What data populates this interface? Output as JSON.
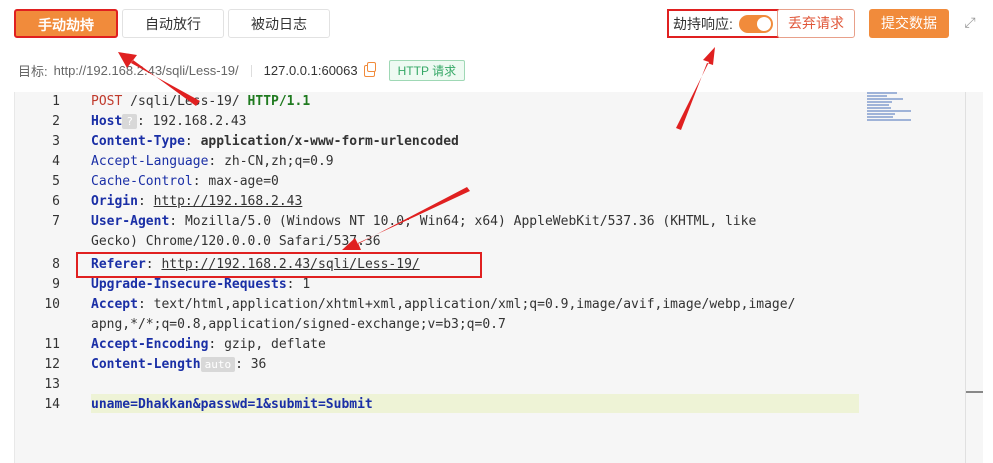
{
  "tabs": [
    {
      "label": "手动劫持",
      "active": true
    },
    {
      "label": "自动放行",
      "active": false
    },
    {
      "label": "被动日志",
      "active": false
    }
  ],
  "hijack_response": {
    "label": "劫持响应:",
    "enabled": true
  },
  "buttons": {
    "discard": "丢弃请求",
    "submit": "提交数据"
  },
  "icons": {
    "expand": "expand-icon",
    "copy": "copy-icon"
  },
  "target": {
    "prefix": "目标:",
    "url": "http://192.168.2.43/sqli/Less-19/",
    "host": "127.0.0.1:60063",
    "badge": "HTTP 请求"
  },
  "request_lines": {
    "l1_method": "POST",
    "l1_path": "/sqli/Less-19/",
    "l1_proto": "HTTP/1.1",
    "l2_key": "Host",
    "l2_hint": "?",
    "l2_val": "192.168.2.43",
    "l3_key": "Content-Type",
    "l3_val": "application/x-www-form-urlencoded",
    "l4_key": "Accept-Language",
    "l4_val": "zh-CN,zh;q=0.9",
    "l5_key": "Cache-Control",
    "l5_val": "max-age=0",
    "l6_key": "Origin",
    "l6_val": "http://192.168.2.43",
    "l7_key": "User-Agent",
    "l7_val_a": "Mozilla/5.0 (Windows NT 10.0; Win64; x64) AppleWebKit/537.36 (KHTML, like",
    "l7_val_b": "Gecko) Chrome/120.0.0.0 Safari/537.36",
    "l8_key": "Referer",
    "l8_val": "http://192.168.2.43/sqli/Less-19/",
    "l9_key": "Upgrade-Insecure-Requests",
    "l9_val": "1",
    "l10_key": "Accept",
    "l10_val_a": "text/html,application/xhtml+xml,application/xml;q=0.9,image/avif,image/webp,image/",
    "l10_val_b": "apng,*/*;q=0.8,application/signed-exchange;v=b3;q=0.7",
    "l11_key": "Accept-Encoding",
    "l11_val": "gzip, deflate",
    "l12_key": "Content-Length",
    "l12_hint": "auto",
    "l12_val": "36",
    "l14_body": "uname=Dhakkan&passwd=1&submit=Submit"
  },
  "line_numbers": [
    "1",
    "2",
    "3",
    "4",
    "5",
    "6",
    "7",
    "8",
    "9",
    "10",
    "11",
    "12",
    "13",
    "14"
  ],
  "colors": {
    "accent": "#f18b3b",
    "annotation": "#e02020",
    "header_key": "#1a2fa6",
    "success": "#35a866"
  }
}
